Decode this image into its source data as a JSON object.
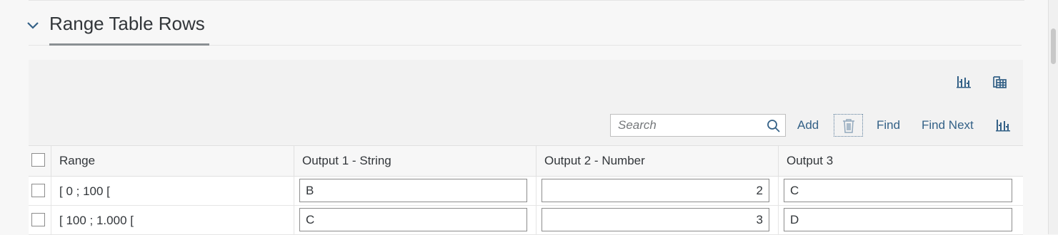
{
  "section": {
    "title": "Range Table Rows",
    "chevron_icon": "chevron-down-icon"
  },
  "toolbar": {
    "icons": [
      "settings-columns-icon",
      "export-table-icon"
    ],
    "search_placeholder": "Search",
    "add_label": "Add",
    "delete_icon": "trash-icon",
    "find_label": "Find",
    "find_next_label": "Find Next",
    "column_settings_icon": "column-settings-icon"
  },
  "table": {
    "columns": [
      "Range",
      "Output 1 - String",
      "Output 2 - Number",
      "Output 3"
    ],
    "rows": [
      {
        "range": "[ 0 ; 100 [",
        "out1": "B",
        "out2": "2",
        "out3": "C"
      },
      {
        "range": "[ 100 ; 1.000 [",
        "out1": "C",
        "out2": "3",
        "out3": "D"
      }
    ]
  },
  "colors": {
    "accent": "#346187",
    "border": "#8c8c8c",
    "background": "#f7f7f7"
  }
}
